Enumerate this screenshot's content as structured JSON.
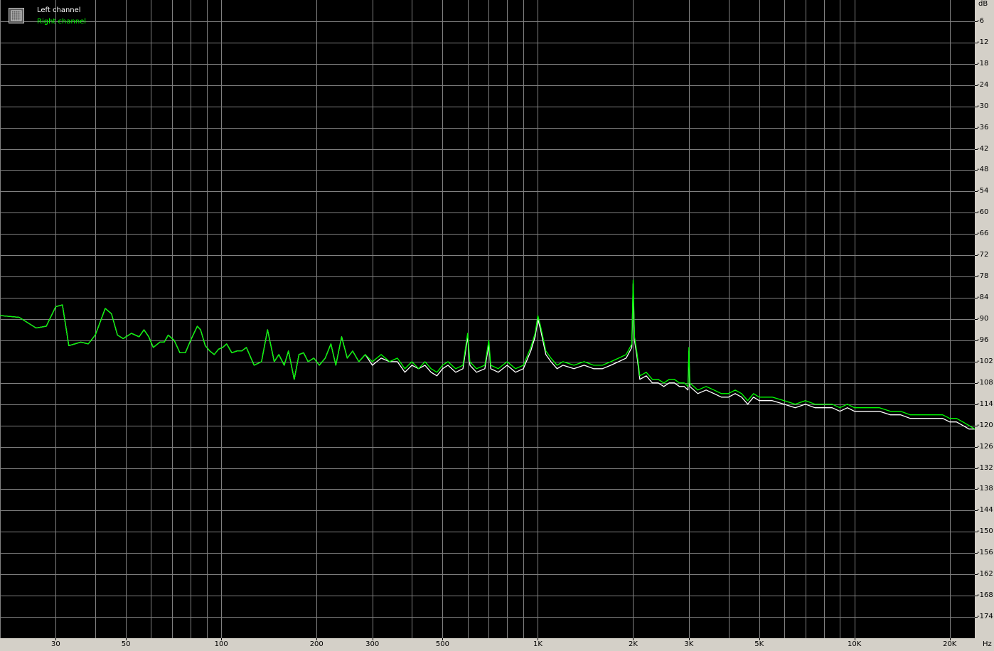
{
  "chart_data": {
    "type": "line",
    "x_scale": "log",
    "xlim": [
      20,
      24000
    ],
    "ylim": [
      -180,
      0
    ],
    "grid": true,
    "legend_position": "top-left",
    "xunit": "Hz",
    "yunit": "dB",
    "x_tick_labels": [
      "30",
      "50",
      "100",
      "200",
      "300",
      "500",
      "1K",
      "2K",
      "3K",
      "5K",
      "10K",
      "20K"
    ],
    "x_tick_values": [
      30,
      50,
      100,
      200,
      300,
      500,
      1000,
      2000,
      3000,
      5000,
      10000,
      20000
    ],
    "y_tick_values": [
      -6,
      -12,
      -18,
      -24,
      -30,
      -36,
      -42,
      -48,
      -54,
      -60,
      -66,
      -72,
      -78,
      -84,
      -90,
      -96,
      -102,
      -108,
      -114,
      -120,
      -126,
      -132,
      -138,
      -144,
      -150,
      -156,
      -162,
      -168,
      -174
    ],
    "series": [
      {
        "name": "Left channel",
        "color": "#ffffff",
        "points": [
          [
            20,
            -89
          ],
          [
            23,
            -89.5
          ],
          [
            26,
            -92.5
          ],
          [
            28,
            -92
          ],
          [
            30,
            -86.5
          ],
          [
            31.5,
            -86
          ],
          [
            33,
            -97.5
          ],
          [
            36,
            -96.5
          ],
          [
            38,
            -97
          ],
          [
            40,
            -94.5
          ],
          [
            43,
            -87
          ],
          [
            45,
            -88.5
          ],
          [
            47,
            -94.5
          ],
          [
            49,
            -95.5
          ],
          [
            52,
            -94
          ],
          [
            55,
            -95
          ],
          [
            57,
            -93
          ],
          [
            59,
            -95
          ],
          [
            61,
            -98
          ],
          [
            64,
            -96.5
          ],
          [
            66,
            -96.5
          ],
          [
            68,
            -94.5
          ],
          [
            71,
            -96
          ],
          [
            74,
            -99.5
          ],
          [
            77,
            -99.5
          ],
          [
            80,
            -96
          ],
          [
            84,
            -92
          ],
          [
            86,
            -93
          ],
          [
            89,
            -97.5
          ],
          [
            92,
            -99
          ],
          [
            95,
            -100
          ],
          [
            98,
            -98.5
          ],
          [
            101,
            -98
          ],
          [
            104,
            -97
          ],
          [
            108,
            -99.5
          ],
          [
            112,
            -99
          ],
          [
            116,
            -99
          ],
          [
            120,
            -98
          ],
          [
            127,
            -103
          ],
          [
            134,
            -102
          ],
          [
            140,
            -93
          ],
          [
            147,
            -102
          ],
          [
            152,
            -100
          ],
          [
            158,
            -103
          ],
          [
            163,
            -99
          ],
          [
            170,
            -107
          ],
          [
            176,
            -100
          ],
          [
            182,
            -99.5
          ],
          [
            188,
            -102
          ],
          [
            196,
            -101
          ],
          [
            204,
            -103
          ],
          [
            213,
            -101
          ],
          [
            222,
            -97
          ],
          [
            230,
            -103
          ],
          [
            240,
            -95
          ],
          [
            250,
            -101
          ],
          [
            260,
            -99
          ],
          [
            272,
            -102
          ],
          [
            285,
            -100
          ],
          [
            300,
            -103
          ],
          [
            320,
            -101
          ],
          [
            340,
            -102
          ],
          [
            360,
            -102
          ],
          [
            380,
            -105
          ],
          [
            400,
            -103
          ],
          [
            420,
            -104
          ],
          [
            440,
            -103
          ],
          [
            460,
            -105
          ],
          [
            480,
            -106
          ],
          [
            500,
            -104
          ],
          [
            520,
            -103
          ],
          [
            550,
            -105
          ],
          [
            580,
            -104
          ],
          [
            600,
            -95
          ],
          [
            610,
            -103
          ],
          [
            640,
            -105
          ],
          [
            680,
            -104
          ],
          [
            700,
            -97
          ],
          [
            710,
            -104
          ],
          [
            750,
            -105
          ],
          [
            800,
            -103
          ],
          [
            850,
            -105
          ],
          [
            900,
            -104
          ],
          [
            950,
            -99
          ],
          [
            980,
            -95
          ],
          [
            1000,
            -90
          ],
          [
            1020,
            -93
          ],
          [
            1060,
            -100
          ],
          [
            1100,
            -102
          ],
          [
            1150,
            -104
          ],
          [
            1200,
            -103
          ],
          [
            1300,
            -104
          ],
          [
            1400,
            -103
          ],
          [
            1500,
            -104
          ],
          [
            1600,
            -104
          ],
          [
            1700,
            -103
          ],
          [
            1800,
            -102
          ],
          [
            1900,
            -101
          ],
          [
            1980,
            -98
          ],
          [
            2000,
            -80
          ],
          [
            2020,
            -96
          ],
          [
            2060,
            -101
          ],
          [
            2100,
            -107
          ],
          [
            2200,
            -106
          ],
          [
            2300,
            -108
          ],
          [
            2400,
            -108
          ],
          [
            2500,
            -109
          ],
          [
            2600,
            -108
          ],
          [
            2700,
            -108
          ],
          [
            2800,
            -109
          ],
          [
            2900,
            -109
          ],
          [
            2980,
            -110
          ],
          [
            3000,
            -99
          ],
          [
            3020,
            -109
          ],
          [
            3200,
            -111
          ],
          [
            3400,
            -110
          ],
          [
            3600,
            -111
          ],
          [
            3800,
            -112
          ],
          [
            4000,
            -112
          ],
          [
            4200,
            -111
          ],
          [
            4400,
            -112
          ],
          [
            4600,
            -114
          ],
          [
            4800,
            -112
          ],
          [
            5000,
            -113
          ],
          [
            5500,
            -113
          ],
          [
            6000,
            -114
          ],
          [
            6500,
            -115
          ],
          [
            7000,
            -114
          ],
          [
            7500,
            -115
          ],
          [
            8000,
            -115
          ],
          [
            8500,
            -115
          ],
          [
            9000,
            -116
          ],
          [
            9500,
            -115
          ],
          [
            10000,
            -116
          ],
          [
            11000,
            -116
          ],
          [
            12000,
            -116
          ],
          [
            13000,
            -117
          ],
          [
            14000,
            -117
          ],
          [
            15000,
            -118
          ],
          [
            16000,
            -118
          ],
          [
            17000,
            -118
          ],
          [
            18000,
            -118
          ],
          [
            19000,
            -118
          ],
          [
            20000,
            -119
          ],
          [
            21000,
            -119
          ],
          [
            22000,
            -120
          ],
          [
            23000,
            -121
          ],
          [
            24000,
            -121
          ]
        ]
      },
      {
        "name": "Right channel",
        "color": "#00ff00",
        "points": [
          [
            20,
            -89
          ],
          [
            23,
            -89.5
          ],
          [
            26,
            -92.5
          ],
          [
            28,
            -92
          ],
          [
            30,
            -86.5
          ],
          [
            31.5,
            -86
          ],
          [
            33,
            -97.5
          ],
          [
            36,
            -96.5
          ],
          [
            38,
            -97
          ],
          [
            40,
            -94.5
          ],
          [
            43,
            -87
          ],
          [
            45,
            -88.5
          ],
          [
            47,
            -94.5
          ],
          [
            49,
            -95.5
          ],
          [
            52,
            -94
          ],
          [
            55,
            -95
          ],
          [
            57,
            -93
          ],
          [
            59,
            -95
          ],
          [
            61,
            -98
          ],
          [
            64,
            -96.5
          ],
          [
            66,
            -96.5
          ],
          [
            68,
            -94.5
          ],
          [
            71,
            -96
          ],
          [
            74,
            -99.5
          ],
          [
            77,
            -99.5
          ],
          [
            80,
            -96
          ],
          [
            84,
            -92
          ],
          [
            86,
            -93
          ],
          [
            89,
            -97.5
          ],
          [
            92,
            -99
          ],
          [
            95,
            -100
          ],
          [
            98,
            -98.5
          ],
          [
            101,
            -98
          ],
          [
            104,
            -97
          ],
          [
            108,
            -99.5
          ],
          [
            112,
            -99
          ],
          [
            116,
            -99
          ],
          [
            120,
            -98
          ],
          [
            127,
            -103
          ],
          [
            134,
            -102
          ],
          [
            140,
            -93
          ],
          [
            147,
            -102
          ],
          [
            152,
            -100
          ],
          [
            158,
            -103
          ],
          [
            163,
            -99
          ],
          [
            170,
            -107
          ],
          [
            176,
            -100
          ],
          [
            182,
            -99.5
          ],
          [
            188,
            -102
          ],
          [
            196,
            -101
          ],
          [
            204,
            -103
          ],
          [
            213,
            -101
          ],
          [
            222,
            -97
          ],
          [
            230,
            -103
          ],
          [
            240,
            -95
          ],
          [
            250,
            -101
          ],
          [
            260,
            -99
          ],
          [
            272,
            -102
          ],
          [
            285,
            -100
          ],
          [
            300,
            -102
          ],
          [
            320,
            -100
          ],
          [
            340,
            -102
          ],
          [
            360,
            -101
          ],
          [
            380,
            -104
          ],
          [
            400,
            -102
          ],
          [
            420,
            -104
          ],
          [
            440,
            -102
          ],
          [
            460,
            -104
          ],
          [
            480,
            -105
          ],
          [
            500,
            -103
          ],
          [
            520,
            -102
          ],
          [
            550,
            -104
          ],
          [
            580,
            -103
          ],
          [
            600,
            -94
          ],
          [
            610,
            -102
          ],
          [
            640,
            -104
          ],
          [
            680,
            -103
          ],
          [
            700,
            -96
          ],
          [
            710,
            -103
          ],
          [
            750,
            -104
          ],
          [
            800,
            -102
          ],
          [
            850,
            -104
          ],
          [
            900,
            -103
          ],
          [
            950,
            -98
          ],
          [
            980,
            -94
          ],
          [
            1000,
            -89
          ],
          [
            1020,
            -92
          ],
          [
            1060,
            -99
          ],
          [
            1100,
            -101
          ],
          [
            1150,
            -103
          ],
          [
            1200,
            -102
          ],
          [
            1300,
            -103
          ],
          [
            1400,
            -102
          ],
          [
            1500,
            -103
          ],
          [
            1600,
            -103
          ],
          [
            1700,
            -102
          ],
          [
            1800,
            -101
          ],
          [
            1900,
            -100
          ],
          [
            1980,
            -97
          ],
          [
            2000,
            -79
          ],
          [
            2020,
            -95
          ],
          [
            2060,
            -100
          ],
          [
            2100,
            -106
          ],
          [
            2200,
            -105
          ],
          [
            2300,
            -107
          ],
          [
            2400,
            -107
          ],
          [
            2500,
            -108
          ],
          [
            2600,
            -107
          ],
          [
            2700,
            -107
          ],
          [
            2800,
            -108
          ],
          [
            2900,
            -108
          ],
          [
            2980,
            -109
          ],
          [
            3000,
            -98
          ],
          [
            3020,
            -108
          ],
          [
            3200,
            -110
          ],
          [
            3400,
            -109
          ],
          [
            3600,
            -110
          ],
          [
            3800,
            -111
          ],
          [
            4000,
            -111
          ],
          [
            4200,
            -110
          ],
          [
            4400,
            -111
          ],
          [
            4600,
            -113
          ],
          [
            4800,
            -111
          ],
          [
            5000,
            -112
          ],
          [
            5500,
            -112
          ],
          [
            6000,
            -113
          ],
          [
            6500,
            -114
          ],
          [
            7000,
            -113
          ],
          [
            7500,
            -114
          ],
          [
            8000,
            -114
          ],
          [
            8500,
            -114
          ],
          [
            9000,
            -115
          ],
          [
            9500,
            -114
          ],
          [
            10000,
            -115
          ],
          [
            11000,
            -115
          ],
          [
            12000,
            -115
          ],
          [
            13000,
            -116
          ],
          [
            14000,
            -116
          ],
          [
            15000,
            -117
          ],
          [
            16000,
            -117
          ],
          [
            17000,
            -117
          ],
          [
            18000,
            -117
          ],
          [
            19000,
            -117
          ],
          [
            20000,
            -118
          ],
          [
            21000,
            -118
          ],
          [
            22000,
            -119
          ],
          [
            23000,
            -120
          ],
          [
            24000,
            -121
          ]
        ]
      }
    ]
  }
}
